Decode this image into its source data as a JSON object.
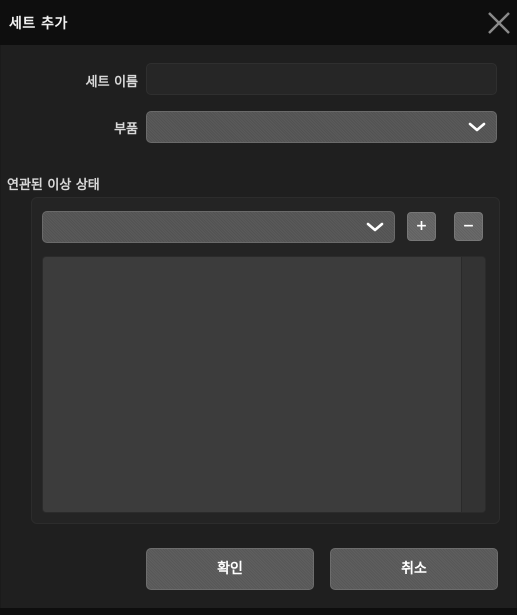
{
  "dialog": {
    "title": "세트 추가",
    "close_icon": "close-icon"
  },
  "form": {
    "set_name_label": "세트 이름",
    "set_name_value": "",
    "part_label": "부품",
    "part_selected": ""
  },
  "related_states": {
    "section_label": "연관된 이상 상태",
    "selected": "",
    "add_label": "+",
    "remove_label": "−",
    "items": []
  },
  "actions": {
    "ok_label": "확인",
    "cancel_label": "취소"
  },
  "colors": {
    "titlebar": "#0e0e0e",
    "background": "#1f1f1f",
    "control": "#5a5a5a",
    "list": "#3c3c3c",
    "text": "#ffffff"
  }
}
